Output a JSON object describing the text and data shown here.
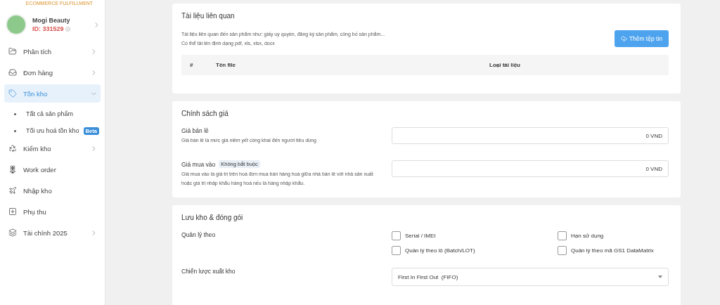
{
  "logo": {
    "tagline": "ECOMMERCE FULFILLMENT"
  },
  "account": {
    "name": "Mogi Beauty",
    "id": "ID: 331529"
  },
  "sidebar": {
    "items": [
      {
        "label": "Phân tích",
        "selected": false,
        "expanded": false
      },
      {
        "label": "Đơn hàng",
        "selected": false,
        "expanded": false
      },
      {
        "label": "Tồn kho",
        "selected": true,
        "expanded": true,
        "children": [
          {
            "label": "Tất cả sản phẩm",
            "selected": false
          },
          {
            "label": "Tối ưu hoá tồn kho",
            "selected": false,
            "badge": "Beta"
          }
        ]
      },
      {
        "label": "Kiểm kho",
        "selected": false,
        "expanded": false
      },
      {
        "label": "Work order",
        "selected": false
      },
      {
        "label": "Nhập kho",
        "selected": false
      },
      {
        "label": "Phụ thu",
        "selected": false
      },
      {
        "label": "Tài chính 2025",
        "selected": false,
        "expanded": false
      }
    ]
  },
  "documents": {
    "title": "Tài liệu liên quan",
    "description": [
      "Tài liệu liên quan đến sản phẩm như: giấy uỷ quyền, đăng ký sản phẩm, công bố sản phẩm...",
      "Có thể tải lên định dạng pdf, xls, xlsx, docx"
    ],
    "button": "Thêm tệp tin",
    "table": {
      "columns": [
        "#",
        "Tên file",
        "Loại tài liệu"
      ]
    }
  },
  "pricing": {
    "title": "Chính sách giá",
    "fields": [
      {
        "label": "Giá bán lẻ",
        "hint": "Giá bán lẻ là mức giá niêm yết công khai đến người tiêu dùng",
        "value": "0 VND"
      },
      {
        "label": "Giá mua vào",
        "badge": "Không bắt buộc",
        "hint": "Giá mua vào là giá trị trên hoá đơn mua bán hàng hoá giữa nhà bán lẻ với nhà sản xuất hoặc giá trị nhập khẩu hàng hoá nếu là hàng nhập khẩu.",
        "value": "0 VND"
      }
    ]
  },
  "storage": {
    "title": "Lưu kho & đóng gói",
    "manage_label": "Quản lý theo",
    "options": [
      {
        "label": "Serial / IMEI",
        "checked": false
      },
      {
        "label": "Hạn sử dụng",
        "checked": false
      },
      {
        "label": "Quản lý theo lô (Batch/LOT)",
        "checked": false
      },
      {
        "label": "Quản lý theo mã GS1 DataMatrix",
        "checked": false
      }
    ],
    "strategy": {
      "label": "Chiến lược xuất kho",
      "value": "First In First Out  (FIFO)"
    }
  }
}
